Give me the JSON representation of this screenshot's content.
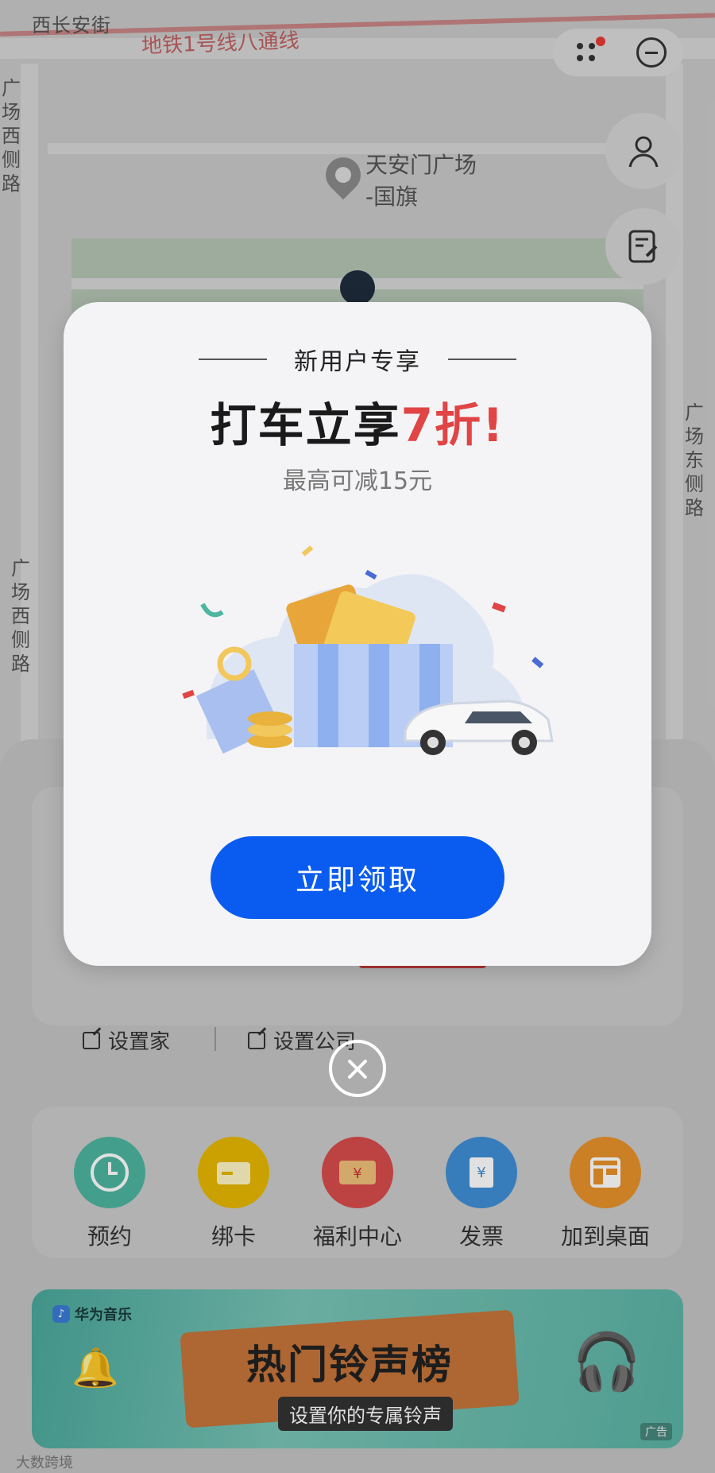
{
  "map": {
    "street_top": "西长安街",
    "metro_line": "地铁1号线八通线",
    "street_left_top": "广场西侧路",
    "street_left_bottom": "广场西侧路",
    "street_right": "广场东侧路",
    "poi_line1": "天安门广场",
    "poi_line2": "-国旗"
  },
  "home_panel": {
    "set_home": "设置家",
    "set_company": "设置公司",
    "quick_actions": [
      {
        "label": "预约",
        "color": "#4db6a0",
        "icon": "clock-icon"
      },
      {
        "label": "绑卡",
        "color": "#e6b800",
        "icon": "card-icon"
      },
      {
        "label": "福利中心",
        "color": "#d84c4c",
        "icon": "coupon-icon"
      },
      {
        "label": "发票",
        "color": "#3f8fd6",
        "icon": "invoice-icon"
      },
      {
        "label": "加到桌面",
        "color": "#e8922c",
        "icon": "desktop-widget-icon"
      }
    ]
  },
  "banner": {
    "brand": "华为音乐",
    "title": "热门铃声榜",
    "subtitle": "设置你的专属铃声",
    "ad_tag": "广告"
  },
  "modal": {
    "kicker": "新用户专享",
    "title_main": "打车立享",
    "title_accent": "7折!",
    "description": "最高可减15元",
    "cta": "立即领取",
    "accent_color": "#e04444",
    "button_color": "#0a5cf0"
  },
  "watermark": "大数跨境"
}
